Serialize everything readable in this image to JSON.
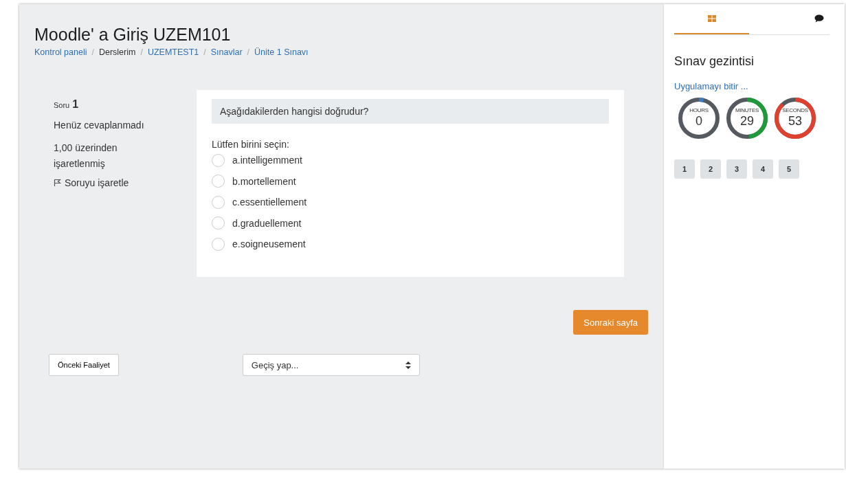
{
  "header": {
    "title": "Moodle' a Giriş UZEM101",
    "separator": "/",
    "breadcrumb": [
      {
        "label": "Kontrol paneli",
        "link": true
      },
      {
        "label": "Derslerim",
        "link": false
      },
      {
        "label": "UZEMTEST1",
        "link": true
      },
      {
        "label": "Sınavlar",
        "link": true
      },
      {
        "label": "Ünite 1 Sınavı",
        "link": true
      }
    ]
  },
  "question_info": {
    "label": "Soru",
    "number": "1",
    "status": "Henüz cevaplanmadı",
    "mark": "1,00 üzerinden işaretlenmiş",
    "flag": "Soruyu işaretle"
  },
  "question": {
    "text": "Aşağıdakilerden hangisi doğrudur?",
    "prompt": "Lütfen birini seçin:",
    "options": [
      {
        "label": "a.intelligemment",
        "checked": false
      },
      {
        "label": "b.mortellement",
        "checked": false
      },
      {
        "label": "c.essentiellement",
        "checked": false
      },
      {
        "label": "d.graduellement",
        "checked": false
      },
      {
        "label": "e.soigneusement",
        "checked": false
      }
    ]
  },
  "next_button": "Sonraki sayfa",
  "previous_button": "Önceki Faaliyet",
  "jump_select": {
    "value": "Geçiş yap..."
  },
  "sidebar": {
    "tabs": [
      {
        "kind": "grid",
        "selected": true
      },
      {
        "kind": "chat",
        "selected": false
      }
    ],
    "title": "Sınav gezintisi",
    "finish_link": "Uygulamayı bitir ...",
    "timers": [
      {
        "label": "HOURS",
        "value": "0",
        "level": 0.04,
        "color": "#3a7cc0"
      },
      {
        "label": "MINUTES",
        "value": "29",
        "level": 0.48,
        "color": "#1f9a3a"
      },
      {
        "label": "SECONDS",
        "value": "53",
        "level": 0.88,
        "color": "#e0402e"
      }
    ],
    "pages": [
      "1",
      "2",
      "3",
      "4",
      "5"
    ]
  }
}
